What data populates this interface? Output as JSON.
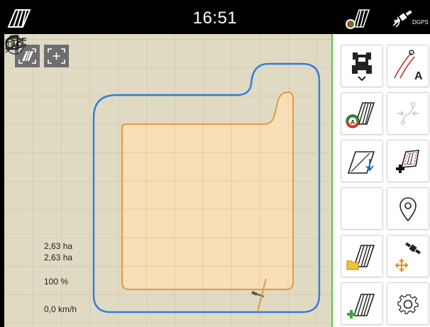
{
  "status_bar": {
    "time": "16:51",
    "gps_label": "DGPS"
  },
  "map": {
    "north_label": "N"
  },
  "info": {
    "area_worked": "2,63 ha",
    "area_total": "2,63 ha",
    "application_rate": "100 %",
    "speed": "0,0 km/h"
  },
  "colors": {
    "field_fill": "#f9dfb8",
    "field_border": "#e39a3f",
    "headland_line": "#2f7de0",
    "panel_border": "#5bc24f",
    "map_background": "#e0dac3"
  },
  "right_panel": {
    "buttons": [
      "tractor-settings-icon",
      "auto-guidance-icon",
      "section-control-icon",
      "track-points-icon",
      "headland-icon",
      "add-boundary-icon",
      "empty",
      "marker-pin-icon",
      "load-field-icon",
      "gps-move-icon",
      "new-field-icon",
      "settings-gear-icon"
    ]
  }
}
